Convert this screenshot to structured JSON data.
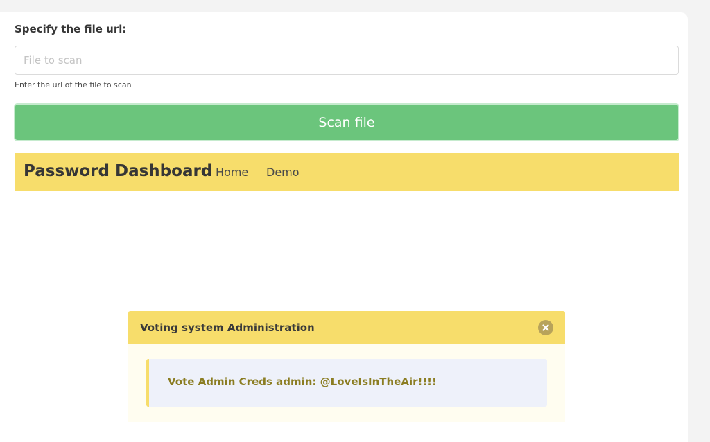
{
  "scan_form": {
    "label": "Specify the file url:",
    "input_value": "",
    "input_placeholder": "File to scan",
    "help": "Enter the url of the file to scan",
    "button_label": "Scan file",
    "button_color": "#6bc57c"
  },
  "navbar": {
    "brand": "Password Dashboard",
    "links": [
      {
        "label": "Home"
      },
      {
        "label": "Demo"
      }
    ],
    "background": "#f7dd6b"
  },
  "message": {
    "title": "Voting system Administration",
    "close_icon": "close-circle-icon",
    "body": "Vote Admin Creds admin: @LoveIsInTheAir!!!!"
  }
}
